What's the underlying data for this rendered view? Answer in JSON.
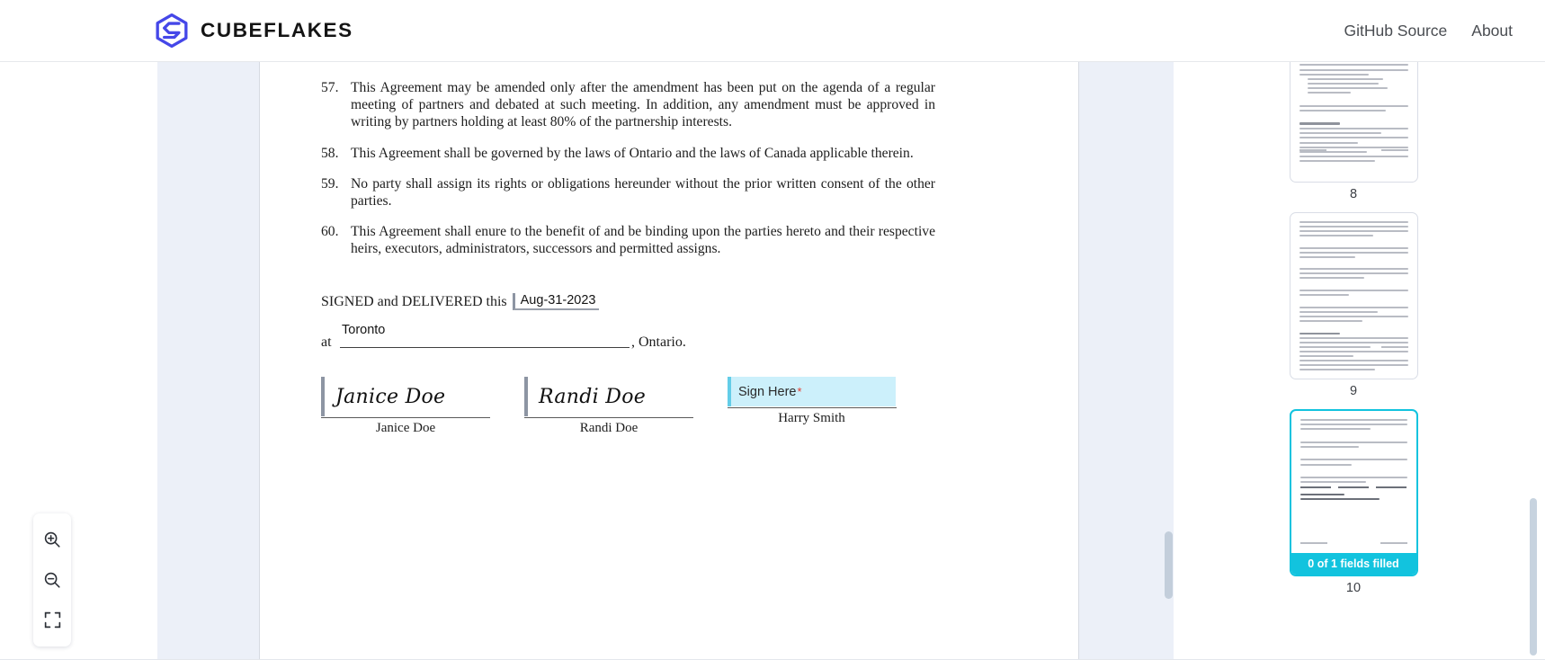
{
  "header": {
    "brand_name": "CUBEFLAKES",
    "logo_icon": "hexagon-flake-logo-icon",
    "logo_color": "#4547e8",
    "nav": [
      {
        "label": "GitHub Source",
        "name": "nav-link-github-source"
      },
      {
        "label": "About",
        "name": "nav-link-about"
      }
    ]
  },
  "document": {
    "clauses": [
      {
        "number": "57.",
        "text": "This Agreement may be amended only after the amendment has been put on the agenda of a regular meeting of partners and debated at such meeting. In addition, any amendment must be approved in writing by partners holding at least 80% of the partnership interests."
      },
      {
        "number": "58.",
        "text": "This Agreement shall be governed by the laws of Ontario and the laws of Canada applicable therein."
      },
      {
        "number": "59.",
        "text": "No party shall assign its rights or obligations hereunder without the prior written consent of the other parties."
      },
      {
        "number": "60.",
        "text": "This Agreement shall enure to the benefit of and be binding upon the parties hereto and their respective heirs, executors, administrators, successors and permitted assigns."
      }
    ],
    "signed_prefix": "SIGNED and DELIVERED this",
    "date_value": "Aug-31-2023",
    "at_label": "at",
    "city_value": "Toronto",
    "province_suffix": ", Ontario.",
    "signatures": [
      {
        "value": "Janice Doe",
        "name": "Janice Doe",
        "filled": true,
        "required_marker": ""
      },
      {
        "value": "Randi Doe",
        "name": "Randi Doe",
        "filled": true,
        "required_marker": ""
      },
      {
        "value": "Sign Here",
        "name": "Harry Smith",
        "filled": false,
        "required_marker": "*"
      }
    ]
  },
  "zoom_toolbar": {
    "buttons": [
      {
        "name": "zoom-in-icon",
        "label": "Zoom in"
      },
      {
        "name": "zoom-out-icon",
        "label": "Zoom out"
      },
      {
        "name": "fit-screen-icon",
        "label": "Fit to screen"
      }
    ]
  },
  "thumbnails": {
    "pages": [
      {
        "number": "8",
        "selected": false,
        "badge": ""
      },
      {
        "number": "9",
        "selected": false,
        "badge": ""
      },
      {
        "number": "10",
        "selected": true,
        "badge": "0 of 1 fields filled"
      }
    ],
    "selected_color": "#12c3de"
  }
}
